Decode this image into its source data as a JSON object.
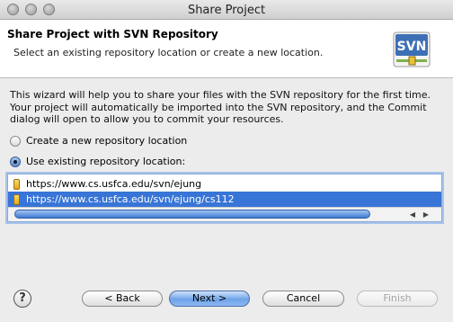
{
  "window": {
    "title": "Share Project"
  },
  "header": {
    "title": "Share Project with SVN Repository",
    "subtitle": "Select an existing repository location or create a new location.",
    "logo_text": "SVN"
  },
  "description": [
    "This wizard will help you to share your files with the SVN repository for the first time.",
    "Your project will automatically be imported into the SVN repository, and the Commit",
    "dialog will open to allow you to commit your resources."
  ],
  "options": {
    "create_new": {
      "label": "Create a new repository location",
      "selected": false
    },
    "use_existing": {
      "label": "Use existing repository location:",
      "selected": true
    }
  },
  "repositories": [
    {
      "url": "https://www.cs.usfca.edu/svn/ejung",
      "selected": false
    },
    {
      "url": "https://www.cs.usfca.edu/svn/ejung/cs112",
      "selected": true
    }
  ],
  "scroll": {
    "left_arrow": "◀",
    "right_arrow": "▶"
  },
  "buttons": {
    "help": "?",
    "back": "< Back",
    "next": "Next >",
    "cancel": "Cancel",
    "finish": "Finish"
  },
  "colors": {
    "selection": "#3875d7",
    "default_button": "#6ea3e8",
    "repo_icon": "#e5a51c"
  }
}
